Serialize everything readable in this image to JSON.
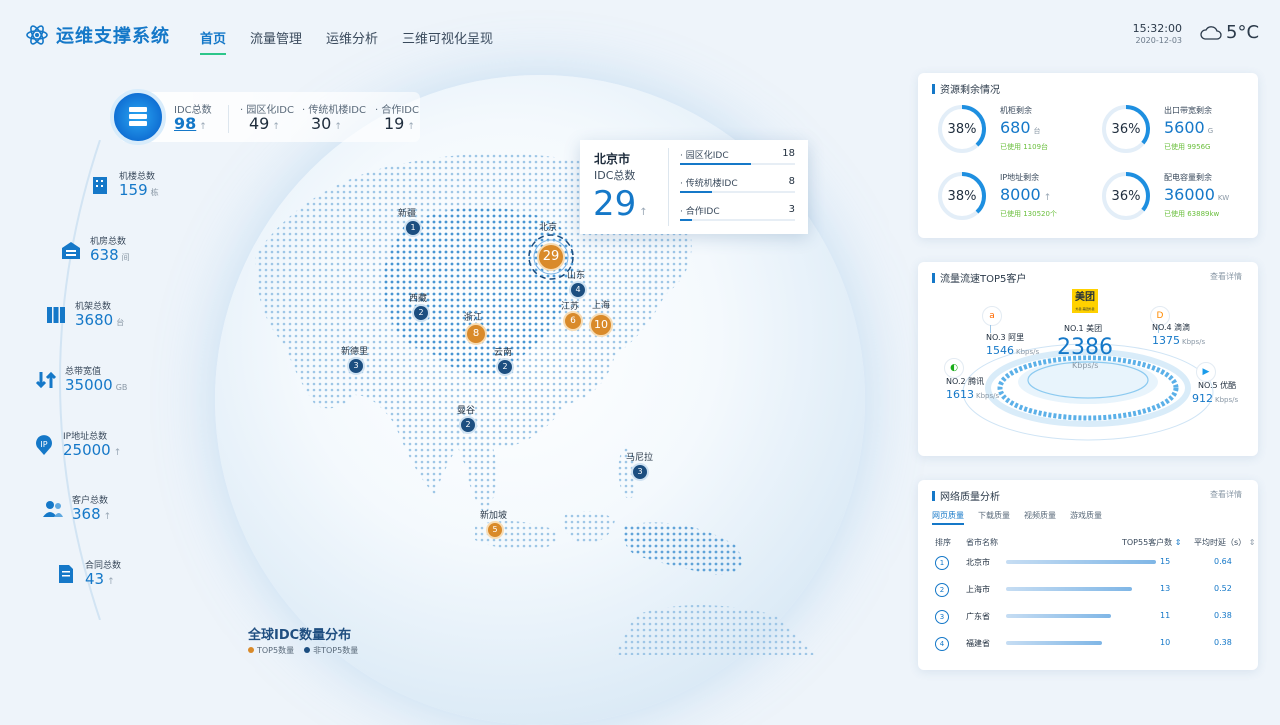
{
  "app": {
    "title": "运维支撑系统"
  },
  "nav": [
    {
      "label": "首页",
      "active": true
    },
    {
      "label": "流量管理",
      "active": false
    },
    {
      "label": "运维分析",
      "active": false
    },
    {
      "label": "三维可视化呈现",
      "active": false
    }
  ],
  "clock": {
    "time": "15:32:00",
    "date": "2020-12-03"
  },
  "weather": {
    "icon": "cloud-icon",
    "temp": "5°C"
  },
  "idc_summary": {
    "total_label": "IDC总数",
    "total": "98",
    "items": [
      {
        "label": "园区化IDC",
        "value": "49"
      },
      {
        "label": "传统机楼IDC",
        "value": "30"
      },
      {
        "label": "合作IDC",
        "value": "19"
      }
    ]
  },
  "stats": [
    {
      "label": "机楼总数",
      "value": "159",
      "unit": "栋",
      "icon": "building-icon",
      "arrow": false
    },
    {
      "label": "机房总数",
      "value": "638",
      "unit": "间",
      "icon": "datacenter-icon",
      "arrow": false
    },
    {
      "label": "机架总数",
      "value": "3680",
      "unit": "台",
      "icon": "rack-icon",
      "arrow": false
    },
    {
      "label": "总带宽值",
      "value": "35000",
      "unit": "GB",
      "icon": "bandwidth-icon",
      "arrow": false
    },
    {
      "label": "IP地址总数",
      "value": "25000",
      "unit": "",
      "icon": "ip-icon",
      "arrow": true
    },
    {
      "label": "客户总数",
      "value": "368",
      "unit": "",
      "icon": "customer-icon",
      "arrow": true
    },
    {
      "label": "合同总数",
      "value": "43",
      "unit": "",
      "icon": "contract-icon",
      "arrow": true
    }
  ],
  "map": {
    "pins": [
      {
        "name": "新疆",
        "value": "1",
        "gold": false
      },
      {
        "name": "北京",
        "value": "29",
        "gold": true
      },
      {
        "name": "山东",
        "value": "4",
        "gold": false
      },
      {
        "name": "西藏",
        "value": "2",
        "gold": false
      },
      {
        "name": "浙江",
        "value": "8",
        "gold": true
      },
      {
        "name": "江苏",
        "value": "6",
        "gold": true
      },
      {
        "name": "上海",
        "value": "10",
        "gold": true
      },
      {
        "name": "新德里",
        "value": "3",
        "gold": false
      },
      {
        "name": "云南",
        "value": "2",
        "gold": false
      },
      {
        "name": "曼谷",
        "value": "2",
        "gold": false
      },
      {
        "name": "马尼拉",
        "value": "3",
        "gold": false
      },
      {
        "name": "新加坡",
        "value": "5",
        "gold": true
      }
    ]
  },
  "popup": {
    "city": "北京市",
    "subtitle": "IDC总数",
    "total": "29",
    "rows": [
      {
        "label": "园区化IDC",
        "value": "18",
        "fraction": 0.62
      },
      {
        "label": "传统机楼IDC",
        "value": "8",
        "fraction": 0.28
      },
      {
        "label": "合作IDC",
        "value": "3",
        "fraction": 0.1
      }
    ]
  },
  "bottom": {
    "title": "全球IDC数量分布",
    "legend": [
      {
        "label": "TOP5数量",
        "color": "#d98a2a"
      },
      {
        "label": "非TOP5数量",
        "color": "#1c4e80"
      }
    ]
  },
  "resources": {
    "title": "资源剩余情况",
    "items": [
      {
        "label": "机柜剩余",
        "percent": "38%",
        "fraction": 0.38,
        "value": "680",
        "unit": "台",
        "used": "已使用 1109台",
        "arrow": false
      },
      {
        "label": "出口带宽剩余",
        "percent": "36%",
        "fraction": 0.36,
        "value": "5600",
        "unit": "G",
        "used": "已使用 9956G",
        "arrow": false
      },
      {
        "label": "IP地址剩余",
        "percent": "38%",
        "fraction": 0.38,
        "value": "8000",
        "unit": "",
        "used": "已使用 130520个",
        "arrow": true
      },
      {
        "label": "配电容量剩余",
        "percent": "36%",
        "fraction": 0.36,
        "value": "36000",
        "unit": "KW",
        "used": "已使用 63889kw",
        "arrow": false
      }
    ]
  },
  "top5": {
    "title": "流量流速TOP5客户",
    "link": "查看详情",
    "center": {
      "logo": "美团",
      "logo_sub": "外卖·美团外卖",
      "rank": "NO.1 美团",
      "value": "2386",
      "unit": "Kbps/s"
    },
    "customers": [
      {
        "rank": "NO.3 阿里",
        "value": "1546",
        "unit": "Kbps/s",
        "icon": "alibaba-icon"
      },
      {
        "rank": "NO.4 滴滴",
        "value": "1375",
        "unit": "Kbps/s",
        "icon": "didi-icon"
      },
      {
        "rank": "NO.2 腾讯",
        "value": "1613",
        "unit": "Kbps/s",
        "icon": "tencent-icon"
      },
      {
        "rank": "NO.5 优酷",
        "value": "912",
        "unit": "Kbps/s",
        "icon": "youku-icon"
      }
    ]
  },
  "quality": {
    "title": "网络质量分析",
    "link": "查看详情",
    "tabs": [
      {
        "label": "网页质量",
        "active": true
      },
      {
        "label": "下载质量",
        "active": false
      },
      {
        "label": "视频质量",
        "active": false
      },
      {
        "label": "游戏质量",
        "active": false
      }
    ],
    "headers": {
      "rank": "排序",
      "city": "省市名称",
      "count": "TOP55客户数",
      "latency": "平均时延（s）"
    },
    "rows": [
      {
        "rank": "1",
        "city": "北京市",
        "count": "15",
        "latency": "0.64",
        "fraction": 1.0
      },
      {
        "rank": "2",
        "city": "上海市",
        "count": "13",
        "latency": "0.52",
        "fraction": 0.84
      },
      {
        "rank": "3",
        "city": "广东省",
        "count": "11",
        "latency": "0.38",
        "fraction": 0.7
      },
      {
        "rank": "4",
        "city": "福建省",
        "count": "10",
        "latency": "0.38",
        "fraction": 0.64
      }
    ]
  }
}
